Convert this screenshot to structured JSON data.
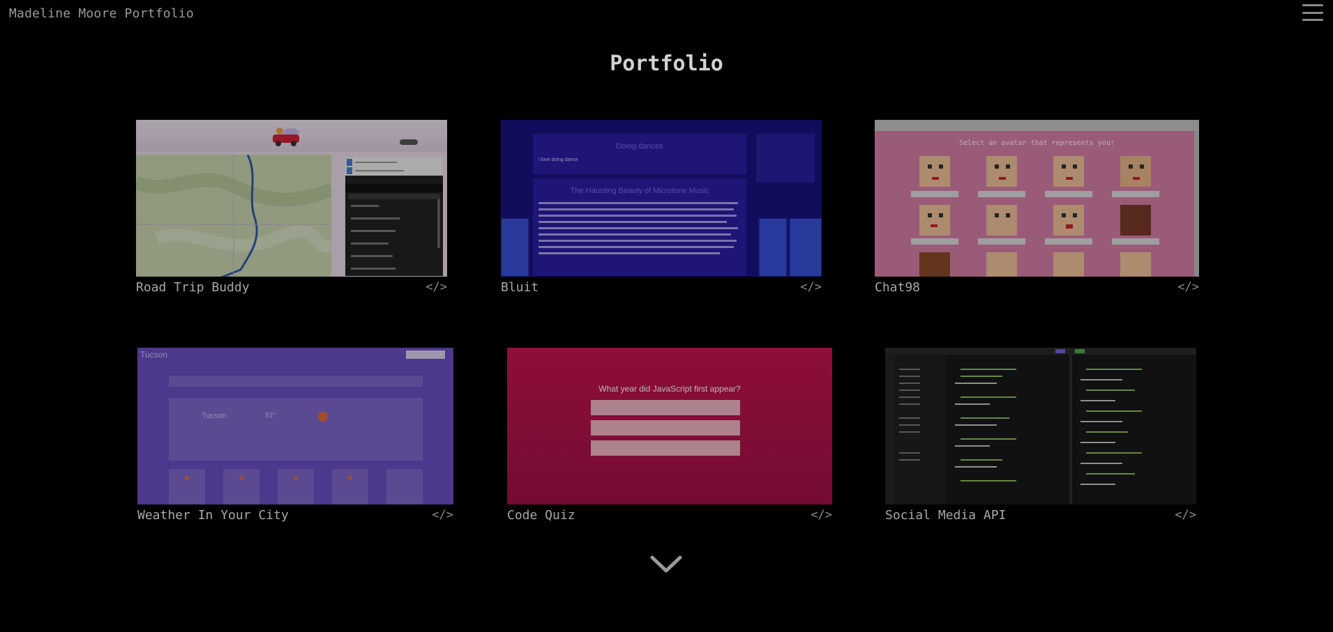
{
  "header": {
    "site_title": "Madeline Moore Portfolio"
  },
  "page_title": "Portfolio",
  "code_icon": "</>",
  "projects": [
    {
      "name": "Road Trip Buddy"
    },
    {
      "name": "Bluit"
    },
    {
      "name": "Chat98"
    },
    {
      "name": "Weather In Your City"
    },
    {
      "name": "Code Quiz"
    },
    {
      "name": "Social Media API"
    }
  ],
  "previews": {
    "bluit": {
      "post1_title": "Doing dances",
      "post1_body": "I love doing dance",
      "post2_title": "The Haunting Beauty of Microtone Music"
    },
    "chat98": {
      "prompt": "Select an avatar that represents you!"
    },
    "weather": {
      "city": "Tucson",
      "temp": "93°"
    },
    "quiz": {
      "question": "What year did JavaScript first appear?"
    }
  },
  "icons": {
    "menu": "hamburger-icon",
    "code": "code-icon",
    "scroll": "chevron-down-icon"
  }
}
